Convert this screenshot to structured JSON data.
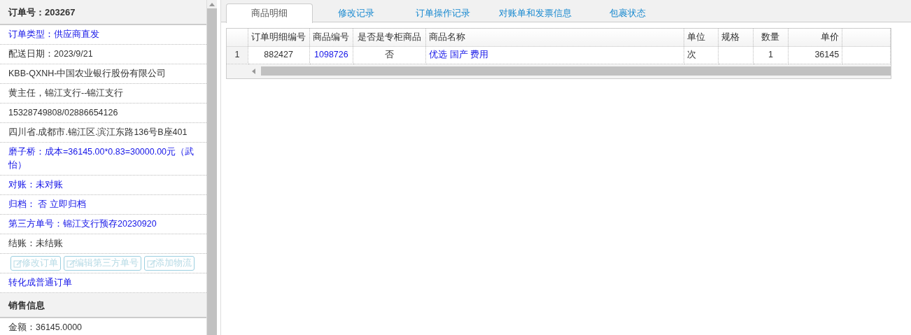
{
  "order_panel": {
    "title": "订单号：203267",
    "rows": [
      {
        "text": "订单类型：供应商直发",
        "kind": "link"
      },
      {
        "text": "配送日期：2023/9/21",
        "kind": "text"
      },
      {
        "text": "KBB-QXNH-中国农业银行股份有限公司",
        "kind": "text"
      },
      {
        "text": "黄主任，锦江支行--锦江支行",
        "kind": "text"
      },
      {
        "text": "15328749808/02886654126",
        "kind": "text"
      },
      {
        "text": "四川省.成都市.锦江区.滨江东路136号B座401",
        "kind": "text"
      },
      {
        "text": "磨子桥：成本=36145.00*0.83=30000.00元（武怡）",
        "kind": "link"
      },
      {
        "text": "对账：未对账",
        "kind": "link"
      },
      {
        "text": "归档： 否 立即归档",
        "kind": "link"
      },
      {
        "text": "第三方单号：锦江支行预存20230920",
        "kind": "link"
      },
      {
        "text": "结账：未结账",
        "kind": "text"
      },
      {
        "kind": "buttons",
        "buttons": [
          {
            "label": "修改订单",
            "disabled": true
          },
          {
            "label": "编辑第三方单号",
            "disabled": true
          },
          {
            "label": "添加物流",
            "disabled": true
          }
        ]
      },
      {
        "text": "转化成普通订单",
        "kind": "link"
      }
    ]
  },
  "sales_panel": {
    "title": "销售信息",
    "rows": [
      {
        "text": "金额：36145.0000",
        "kind": "text"
      }
    ]
  },
  "tabs": [
    {
      "label": "商品明细",
      "selected": true
    },
    {
      "label": "修改记录",
      "selected": false
    },
    {
      "label": "订单操作记录",
      "selected": false
    },
    {
      "label": "对账单和发票信息",
      "selected": false
    },
    {
      "label": "包裹状态",
      "selected": false
    }
  ],
  "table": {
    "columns": [
      "订单明细编号",
      "商品编号",
      "是否是专柜商品",
      "商品名称",
      "单位",
      "规格",
      "数量",
      "单价"
    ],
    "rows": [
      {
        "number": "1",
        "cells": [
          {
            "text": "882427",
            "link": false
          },
          {
            "text": "1098726",
            "link": true
          },
          {
            "text": "否",
            "link": false
          },
          {
            "text": "优选 国产 费用",
            "link": true
          },
          {
            "text": "次",
            "link": false
          },
          {
            "text": ""
          },
          {
            "text": "1",
            "link": false
          },
          {
            "text": "36145",
            "link": false
          }
        ]
      }
    ]
  }
}
